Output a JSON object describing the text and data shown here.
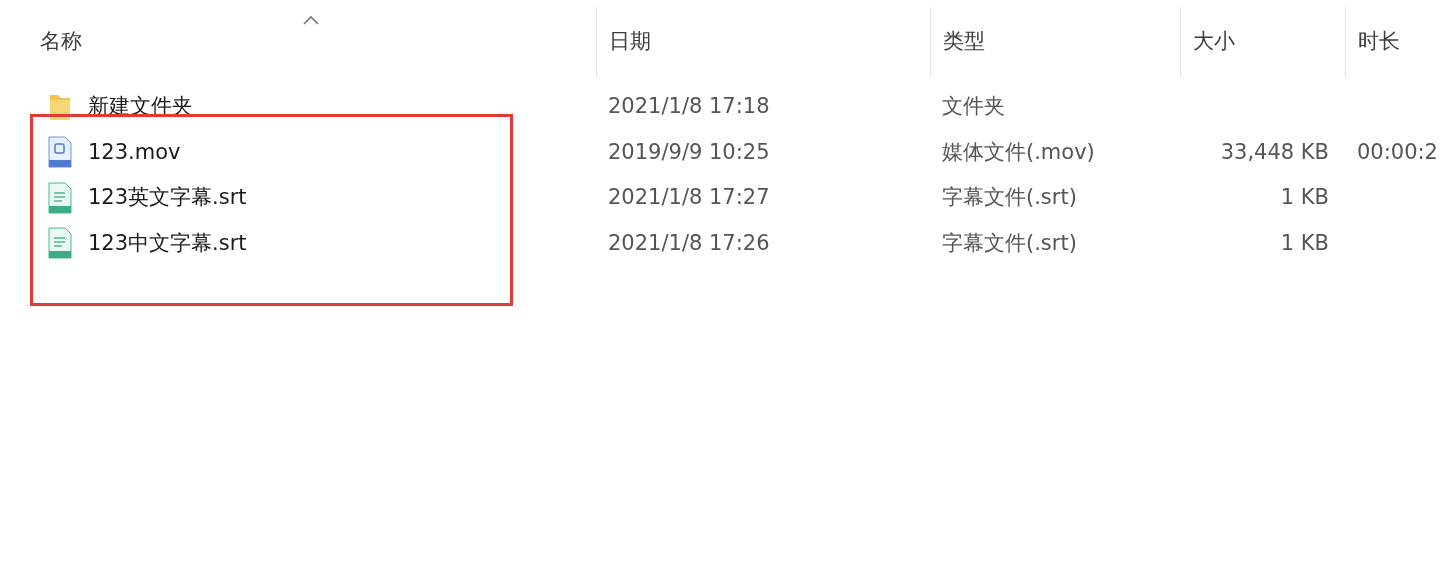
{
  "columns": [
    {
      "label": "名称",
      "sorted": true
    },
    {
      "label": "日期",
      "sorted": false
    },
    {
      "label": "类型",
      "sorted": false
    },
    {
      "label": "大小",
      "sorted": false
    },
    {
      "label": "时长",
      "sorted": false
    }
  ],
  "rows": [
    {
      "kind": "folder",
      "name": "新建文件夹",
      "date": "2021/1/8 17:18",
      "type": "文件夹"
    },
    {
      "kind": "video",
      "name": "123.mov",
      "date": "2019/9/9 10:25",
      "type": "媒体文件(.mov)",
      "size": "33,448 KB",
      "duration": "00:00:2"
    },
    {
      "kind": "subtitle",
      "name": "123英文字幕.srt",
      "date": "2021/1/8 17:27",
      "type": "字幕文件(.srt)",
      "size": "1 KB"
    },
    {
      "kind": "subtitle",
      "name": "123中文字幕.srt",
      "date": "2021/1/8 17:26",
      "type": "字幕文件(.srt)",
      "size": "1 KB"
    }
  ],
  "annotation": {
    "kind": "highlight-frame",
    "color": "#e53935"
  }
}
